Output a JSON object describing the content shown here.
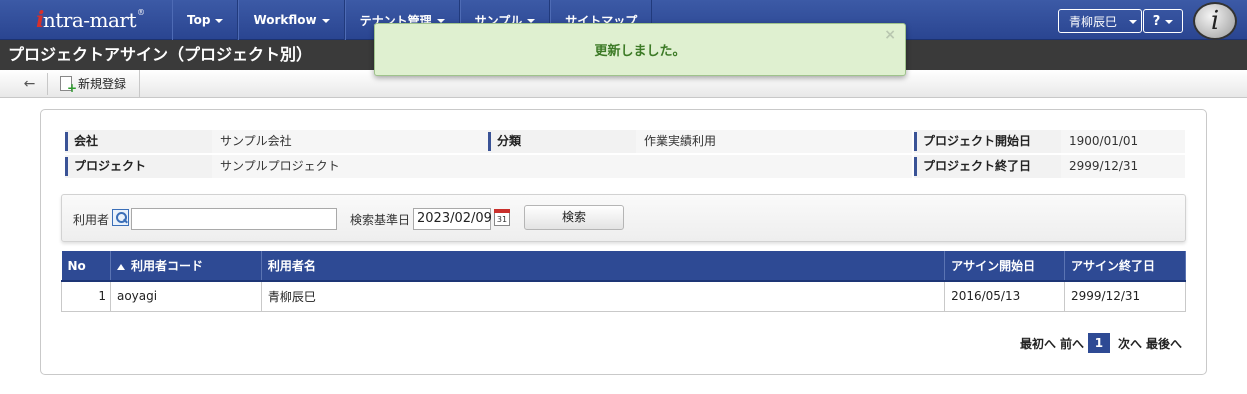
{
  "topnav": {
    "logo_i": "i",
    "logo_text": "ntra-mart",
    "logo_reg": "®",
    "menu": [
      {
        "label": "Top"
      },
      {
        "label": "Workflow"
      },
      {
        "label": "テナント管理"
      },
      {
        "label": "サンプル"
      },
      {
        "label": "サイトマップ"
      }
    ],
    "user_name": "青柳辰巳",
    "help_label": "?",
    "badge_letter": "i"
  },
  "title": "プロジェクトアサイン（プロジェクト別）",
  "toolbar": {
    "back_icon": "←",
    "new_label": "新規登録"
  },
  "toast": {
    "message": "更新しました。",
    "close": "×"
  },
  "info": {
    "company_label": "会社",
    "company_value": "サンプル会社",
    "category_label": "分類",
    "category_value": "作業実績利用",
    "start_label": "プロジェクト開始日",
    "start_value": "1900/01/01",
    "project_label": "プロジェクト",
    "project_value": "サンプルプロジェクト",
    "end_label": "プロジェクト終了日",
    "end_value": "2999/12/31"
  },
  "search": {
    "user_label": "利用者",
    "user_value": "",
    "date_label": "検索基準日",
    "date_value": "2023/02/09",
    "calendar_day": "31",
    "button_label": "検索"
  },
  "table": {
    "headers": [
      "No",
      "利用者コード",
      "利用者名",
      "アサイン開始日",
      "アサイン終了日"
    ],
    "rows": [
      [
        "1",
        "aoyagi",
        "青柳辰巳",
        "2016/05/13",
        "2999/12/31"
      ]
    ]
  },
  "pager": {
    "first": "最初へ",
    "prev": "前へ",
    "current": "1",
    "next": "次へ",
    "last": "最後へ"
  }
}
